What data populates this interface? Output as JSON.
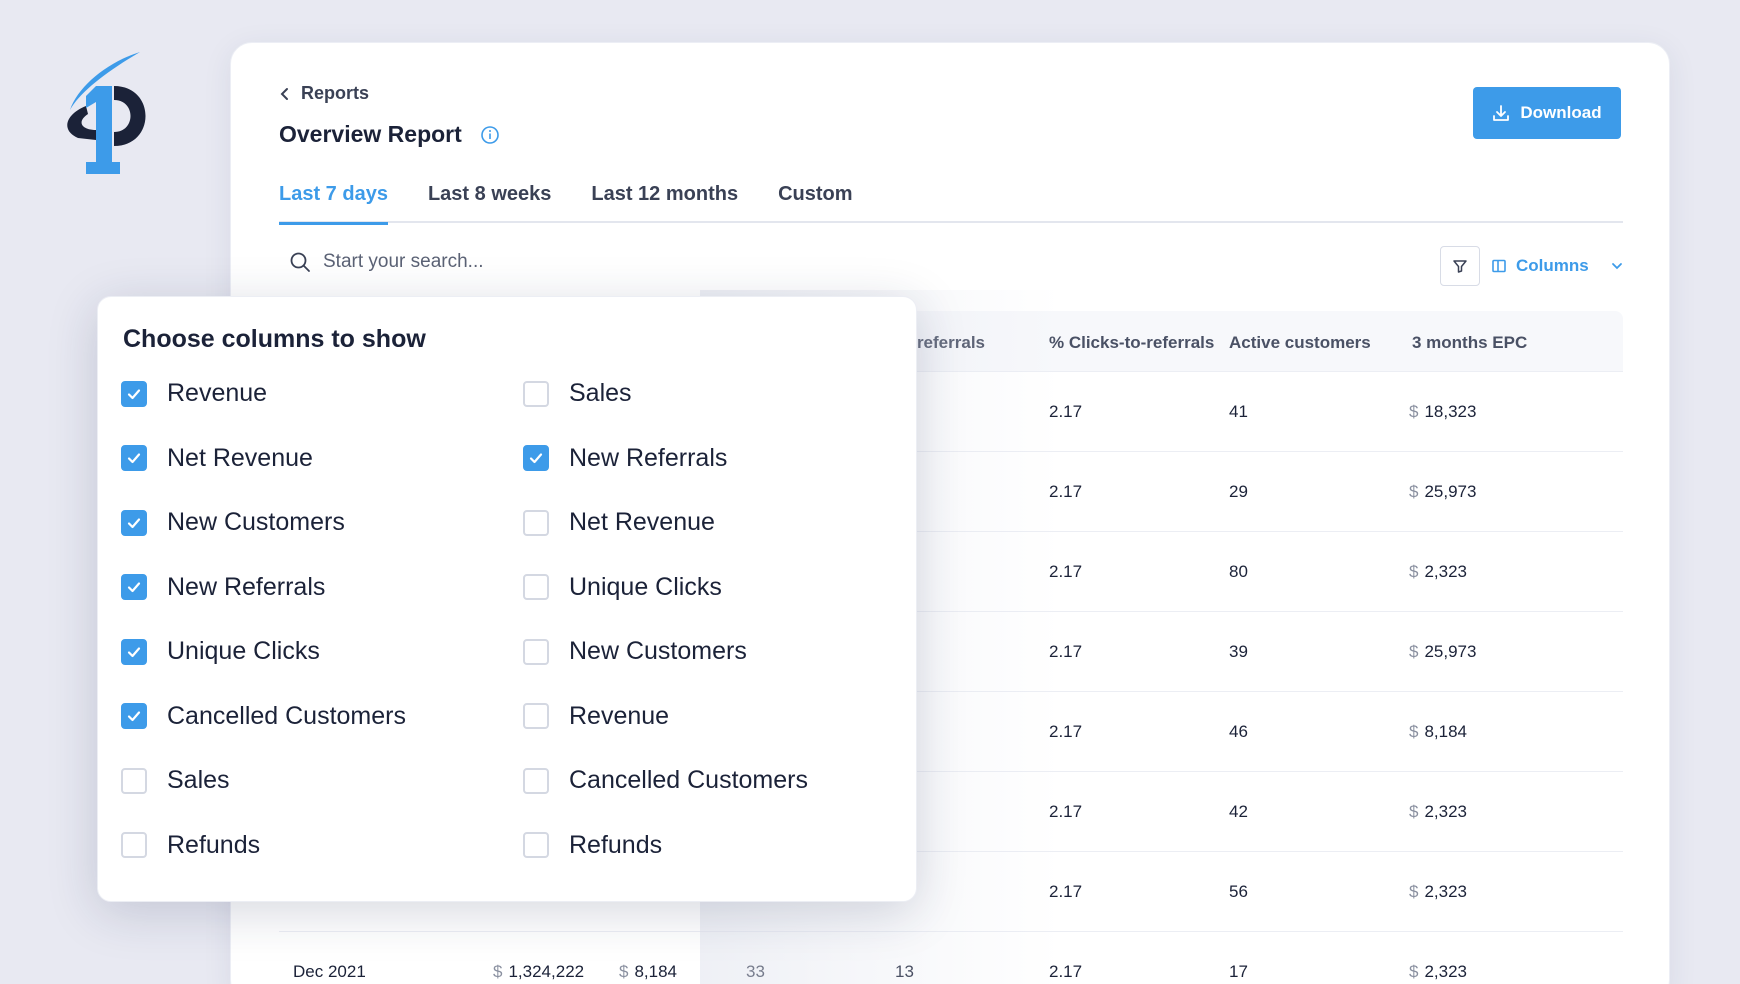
{
  "breadcrumb": {
    "back_label": "Reports"
  },
  "header": {
    "title": "Overview Report",
    "download_label": "Download"
  },
  "tabs": [
    {
      "label": "Last 7 days",
      "active": true
    },
    {
      "label": "Last 8 weeks",
      "active": false
    },
    {
      "label": "Last 12 months",
      "active": false
    },
    {
      "label": "Custom",
      "active": false
    }
  ],
  "search": {
    "placeholder": "Start your search..."
  },
  "toolbar": {
    "columns_label": "Columns"
  },
  "table": {
    "headers": [
      "w referrals",
      "% Clicks-to-referrals",
      "Active customers",
      "3 months EPC"
    ],
    "rows": [
      {
        "ctr": "2.17",
        "active": "41",
        "epc": "18,323"
      },
      {
        "ctr": "2.17",
        "active": "29",
        "epc": "25,973"
      },
      {
        "ctr": "2.17",
        "active": "80",
        "epc": "2,323"
      },
      {
        "ctr": "2.17",
        "active": "39",
        "epc": "25,973"
      },
      {
        "ctr": "2.17",
        "active": "46",
        "epc": "8,184"
      },
      {
        "ctr": "2.17",
        "active": "42",
        "epc": "2,323"
      },
      {
        "ctr": "2.17",
        "active": "56",
        "epc": "2,323"
      }
    ],
    "last_row": {
      "date": "Dec 2021",
      "revenue": "1,324,222",
      "net_revenue": "8,184",
      "new_customers": "33",
      "new_referrals": "13",
      "ctr": "2.17",
      "active": "17",
      "epc": "2,323"
    },
    "currency_symbol": "$"
  },
  "columns_popup": {
    "title": "Choose columns to show",
    "left": [
      {
        "label": "Revenue",
        "checked": true
      },
      {
        "label": "Net Revenue",
        "checked": true
      },
      {
        "label": "New Customers",
        "checked": true
      },
      {
        "label": "New Referrals",
        "checked": true
      },
      {
        "label": "Unique Clicks",
        "checked": true
      },
      {
        "label": "Cancelled Customers",
        "checked": true
      },
      {
        "label": "Sales",
        "checked": false
      },
      {
        "label": "Refunds",
        "checked": false
      }
    ],
    "right": [
      {
        "label": "Sales",
        "checked": false
      },
      {
        "label": "New Referrals",
        "checked": true
      },
      {
        "label": "Net Revenue",
        "checked": false
      },
      {
        "label": "Unique Clicks",
        "checked": false
      },
      {
        "label": "New Customers",
        "checked": false
      },
      {
        "label": "Revenue",
        "checked": false
      },
      {
        "label": "Cancelled Customers",
        "checked": false
      },
      {
        "label": "Refunds",
        "checked": false
      }
    ]
  },
  "colors": {
    "accent": "#3d9be9",
    "navy": "#1b2238",
    "background": "#e8e9f2"
  },
  "icons": {
    "logo": "brand-logo",
    "back": "chevron-left-icon",
    "info": "info-icon",
    "download": "download-icon",
    "search": "search-icon",
    "filter": "filter-icon",
    "columns": "columns-icon",
    "chevron": "chevron-down-icon",
    "check": "check-icon"
  }
}
